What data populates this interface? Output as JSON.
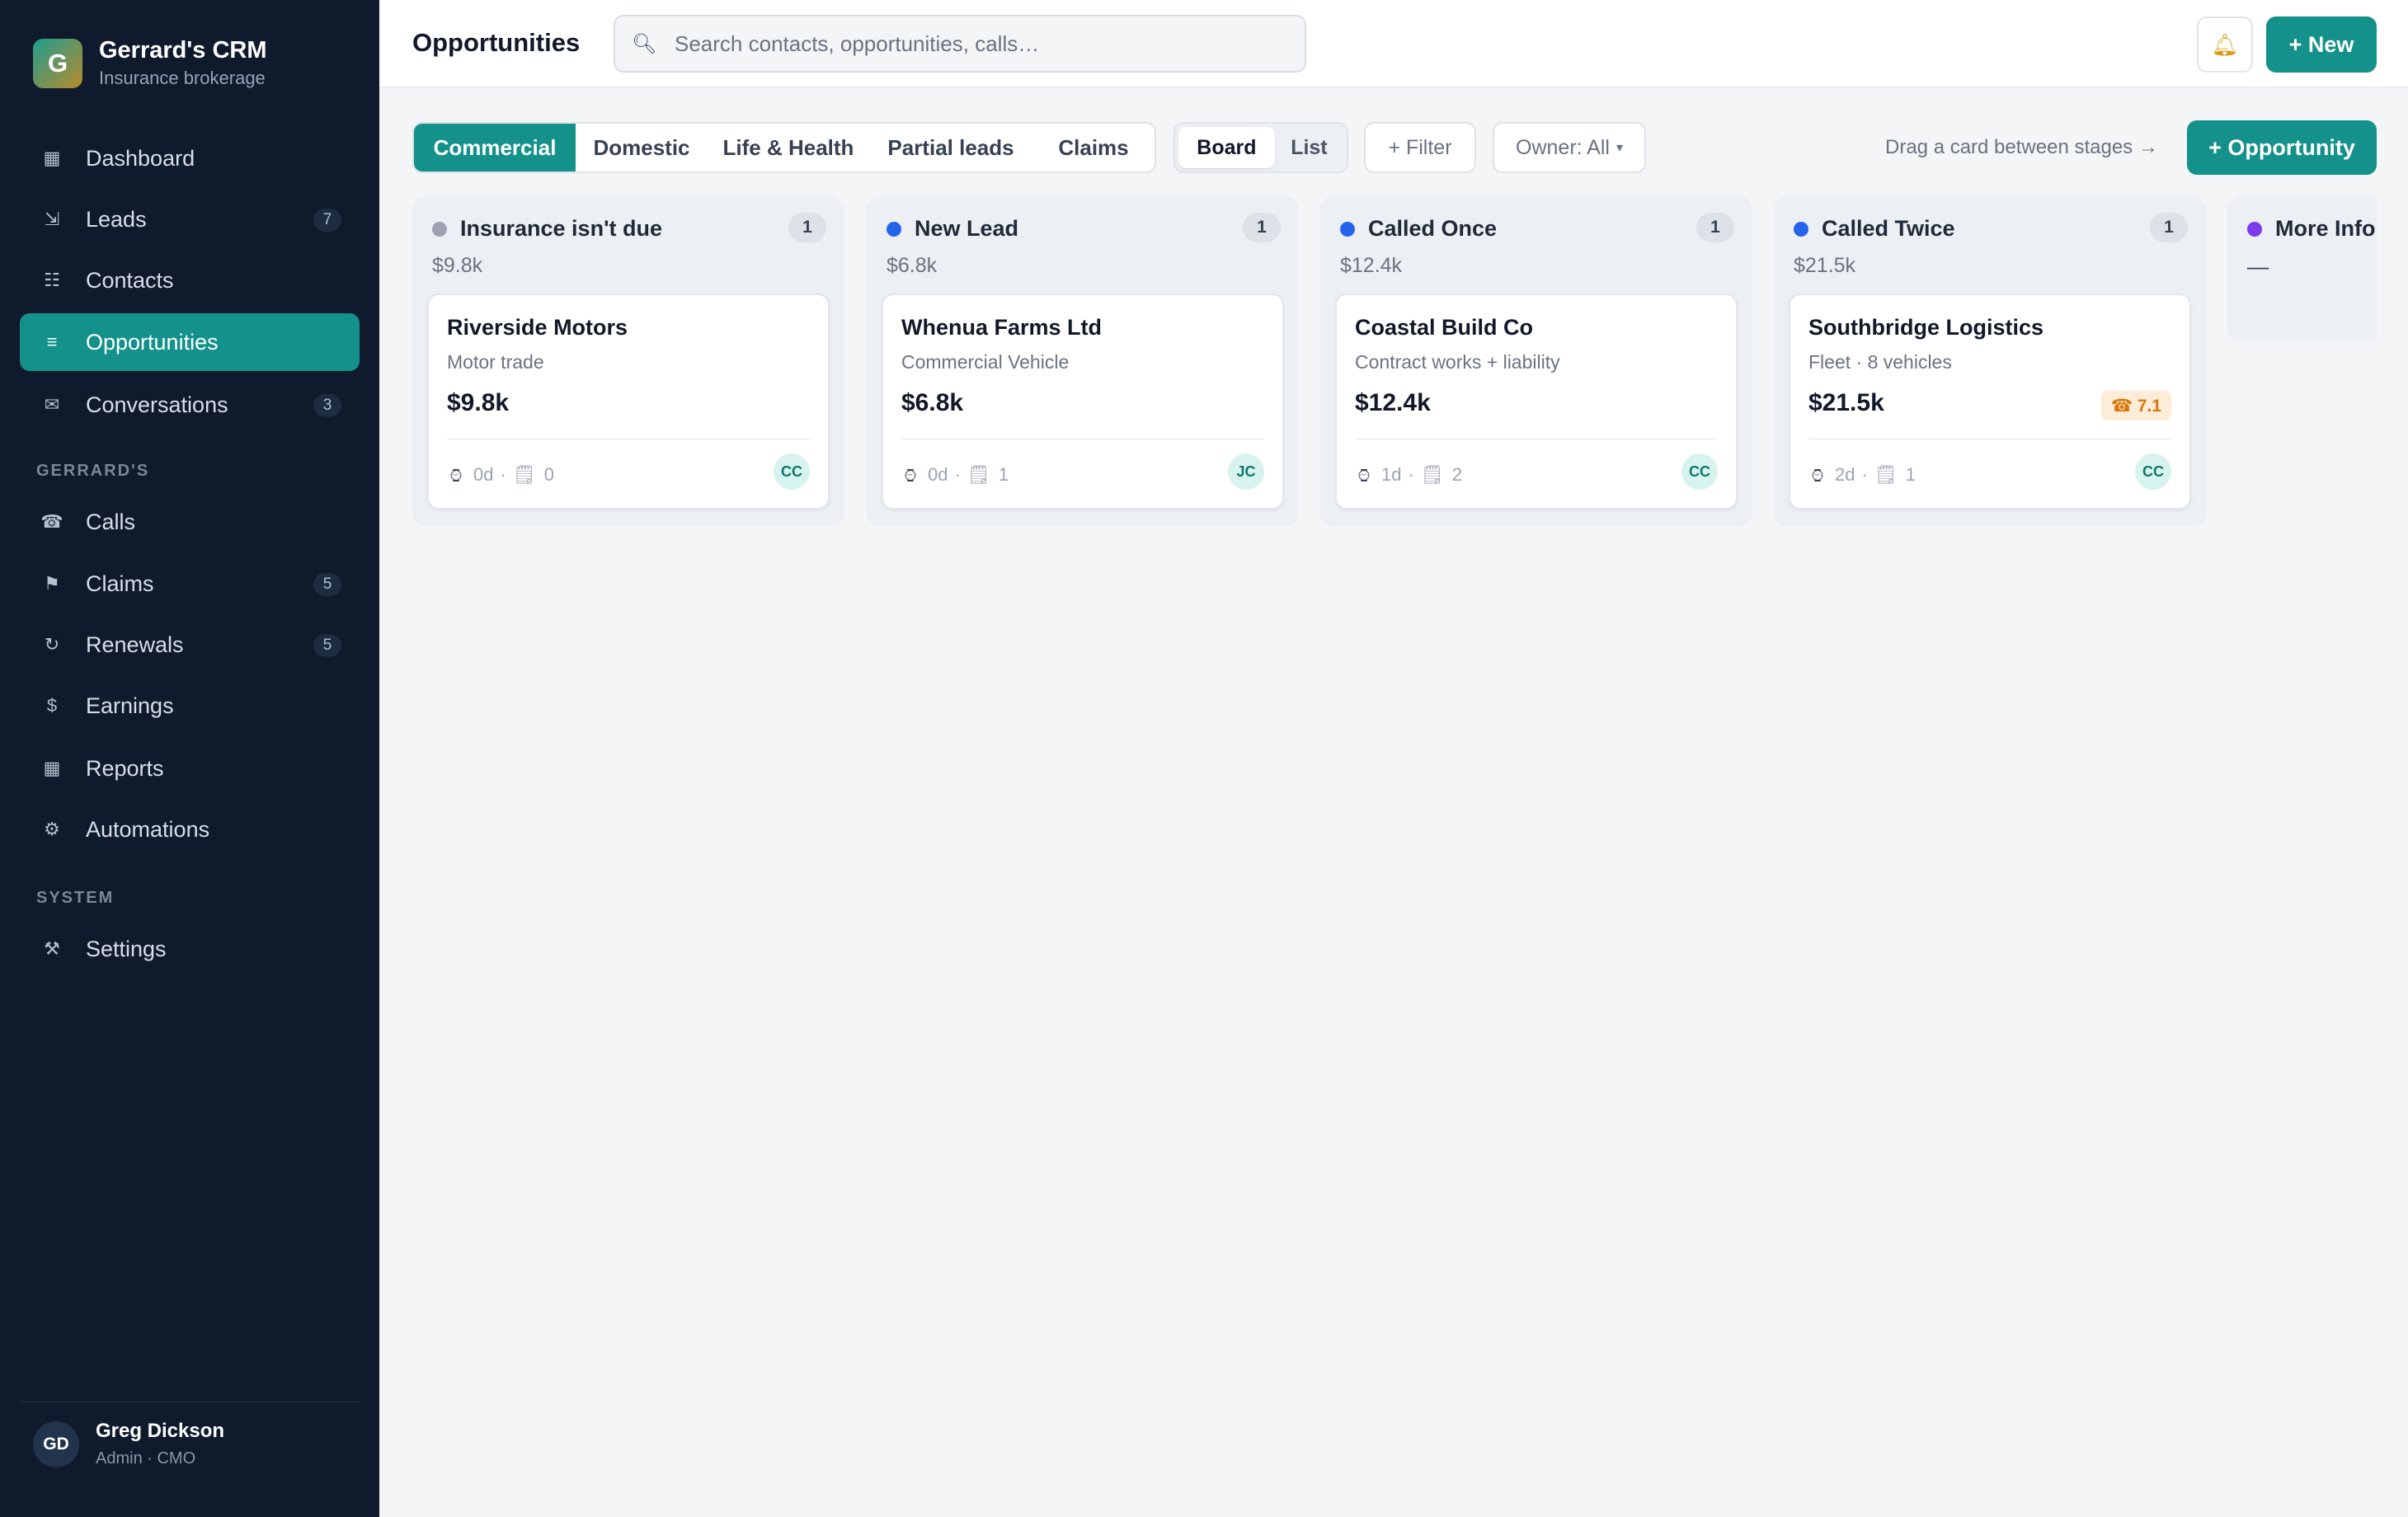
{
  "app": {
    "name": "Gerrard's CRM",
    "subtitle": "Insurance brokerage",
    "logo_letter": "G"
  },
  "sidebar": {
    "items": [
      {
        "label": "Dashboard",
        "icon": "grid-icon",
        "glyph": "▦"
      },
      {
        "label": "Leads",
        "icon": "arrow-in-icon",
        "glyph": "⇲",
        "badge": "7"
      },
      {
        "label": "Contacts",
        "icon": "contacts-icon",
        "glyph": "☷"
      },
      {
        "label": "Opportunities",
        "icon": "list-icon",
        "glyph": "≡",
        "active": true
      },
      {
        "label": "Conversations",
        "icon": "mail-icon",
        "glyph": "✉",
        "badge": "3"
      }
    ],
    "section_gerrards": "GERRARD'S",
    "gerrards_items": [
      {
        "label": "Calls",
        "icon": "phone-icon",
        "glyph": "☎"
      },
      {
        "label": "Claims",
        "icon": "flag-icon",
        "glyph": "⚑",
        "badge": "5"
      },
      {
        "label": "Renewals",
        "icon": "refresh-icon",
        "glyph": "↻",
        "badge": "5"
      },
      {
        "label": "Earnings",
        "icon": "dollar-icon",
        "glyph": "$"
      },
      {
        "label": "Reports",
        "icon": "report-icon",
        "glyph": "▦"
      },
      {
        "label": "Automations",
        "icon": "gear-icon",
        "glyph": "⚙"
      }
    ],
    "section_system": "SYSTEM",
    "system_items": [
      {
        "label": "Settings",
        "icon": "tools-icon",
        "glyph": "⚒"
      }
    ],
    "user": {
      "initials": "GD",
      "name": "Greg Dickson",
      "role": "Admin · CMO"
    }
  },
  "header": {
    "title": "Opportunities",
    "search_placeholder": "Search contacts, opportunities, calls…",
    "new_label": "+ New"
  },
  "toolbar": {
    "tabs": [
      "Commercial",
      "Domestic",
      "Life & Health",
      "Partial leads",
      "Claims"
    ],
    "active_tab": "Commercial",
    "views": [
      "Board",
      "List"
    ],
    "active_view": "Board",
    "filter_label": "+ Filter",
    "owner_label": "Owner: All",
    "drag_hint": "Drag a card between stages →",
    "opportunity_label": "+ Opportunity"
  },
  "colors": {
    "accent": "#13918a",
    "sidebar": "#0f1b2d",
    "stage_grey": "#9ca3af",
    "stage_blue": "#2563eb",
    "stage_purple": "#7c3aed",
    "tag_orange": "#d97706"
  },
  "board": {
    "columns": [
      {
        "name": "Insurance isn't due",
        "count": "1",
        "total": "$9.8k",
        "dot": "#9ca3af",
        "card": {
          "title": "Riverside Motors",
          "sub": "Motor trade",
          "value": "$9.8k",
          "age": "0d",
          "notes": "0",
          "owner": "CC"
        }
      },
      {
        "name": "New Lead",
        "count": "1",
        "total": "$6.8k",
        "dot": "#2563eb",
        "card": {
          "title": "Whenua Farms Ltd",
          "sub": "Commercial Vehicle",
          "value": "$6.8k",
          "age": "0d",
          "notes": "1",
          "owner": "JC"
        }
      },
      {
        "name": "Called Once",
        "count": "1",
        "total": "$12.4k",
        "dot": "#2563eb",
        "card": {
          "title": "Coastal Build Co",
          "sub": "Contract works + liability",
          "value": "$12.4k",
          "age": "1d",
          "notes": "2",
          "owner": "CC"
        }
      },
      {
        "name": "Called Twice",
        "count": "1",
        "total": "$21.5k",
        "dot": "#2563eb",
        "card": {
          "title": "Southbridge Logistics",
          "sub": "Fleet · 8 vehicles",
          "value": "$21.5k",
          "tag": "☎ 7.1",
          "age": "2d",
          "notes": "1",
          "owner": "CC"
        }
      },
      {
        "name": "More Info",
        "total": "—",
        "dot": "#7c3aed"
      }
    ]
  }
}
